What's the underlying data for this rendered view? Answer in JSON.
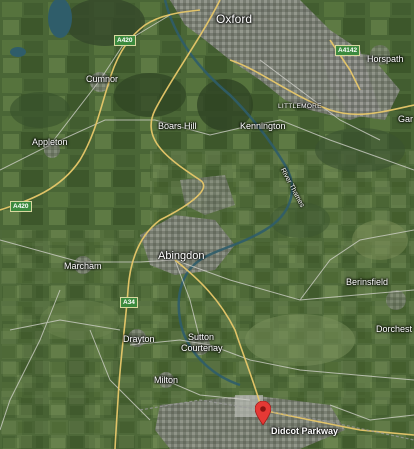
{
  "map": {
    "places": {
      "oxford": "Oxford",
      "cumnor": "Cumnor",
      "horspath": "Horspath",
      "appleton": "Appleton",
      "boars_hill": "Boars Hill",
      "kennington": "Kennington",
      "littlemore": "LITTLEMORE",
      "gar": "Gar",
      "abingdon": "Abingdon",
      "marcham": "Marcham",
      "berinsfield": "Berinsfield",
      "dorchester": "Dorchest",
      "drayton": "Drayton",
      "sutton_courtenay_1": "Sutton",
      "sutton_courtenay_2": "Courtenay",
      "milton": "Milton",
      "didcot": "Didcot Parkway"
    },
    "water": {
      "river_thames": "River Thames"
    },
    "roads": {
      "a420_north": "A420",
      "a420_west": "A420",
      "a4142": "A4142",
      "a34": "A34"
    },
    "marker": {
      "icon": "map-pin-icon",
      "color": "#e53935",
      "label": "Didcot Parkway"
    },
    "colors": {
      "farmland": "#4a6636",
      "road_major": "#e8c86a",
      "road_minor": "#cfcfcf",
      "urban": "#8a8c86",
      "water": "#2f5d6a"
    }
  }
}
